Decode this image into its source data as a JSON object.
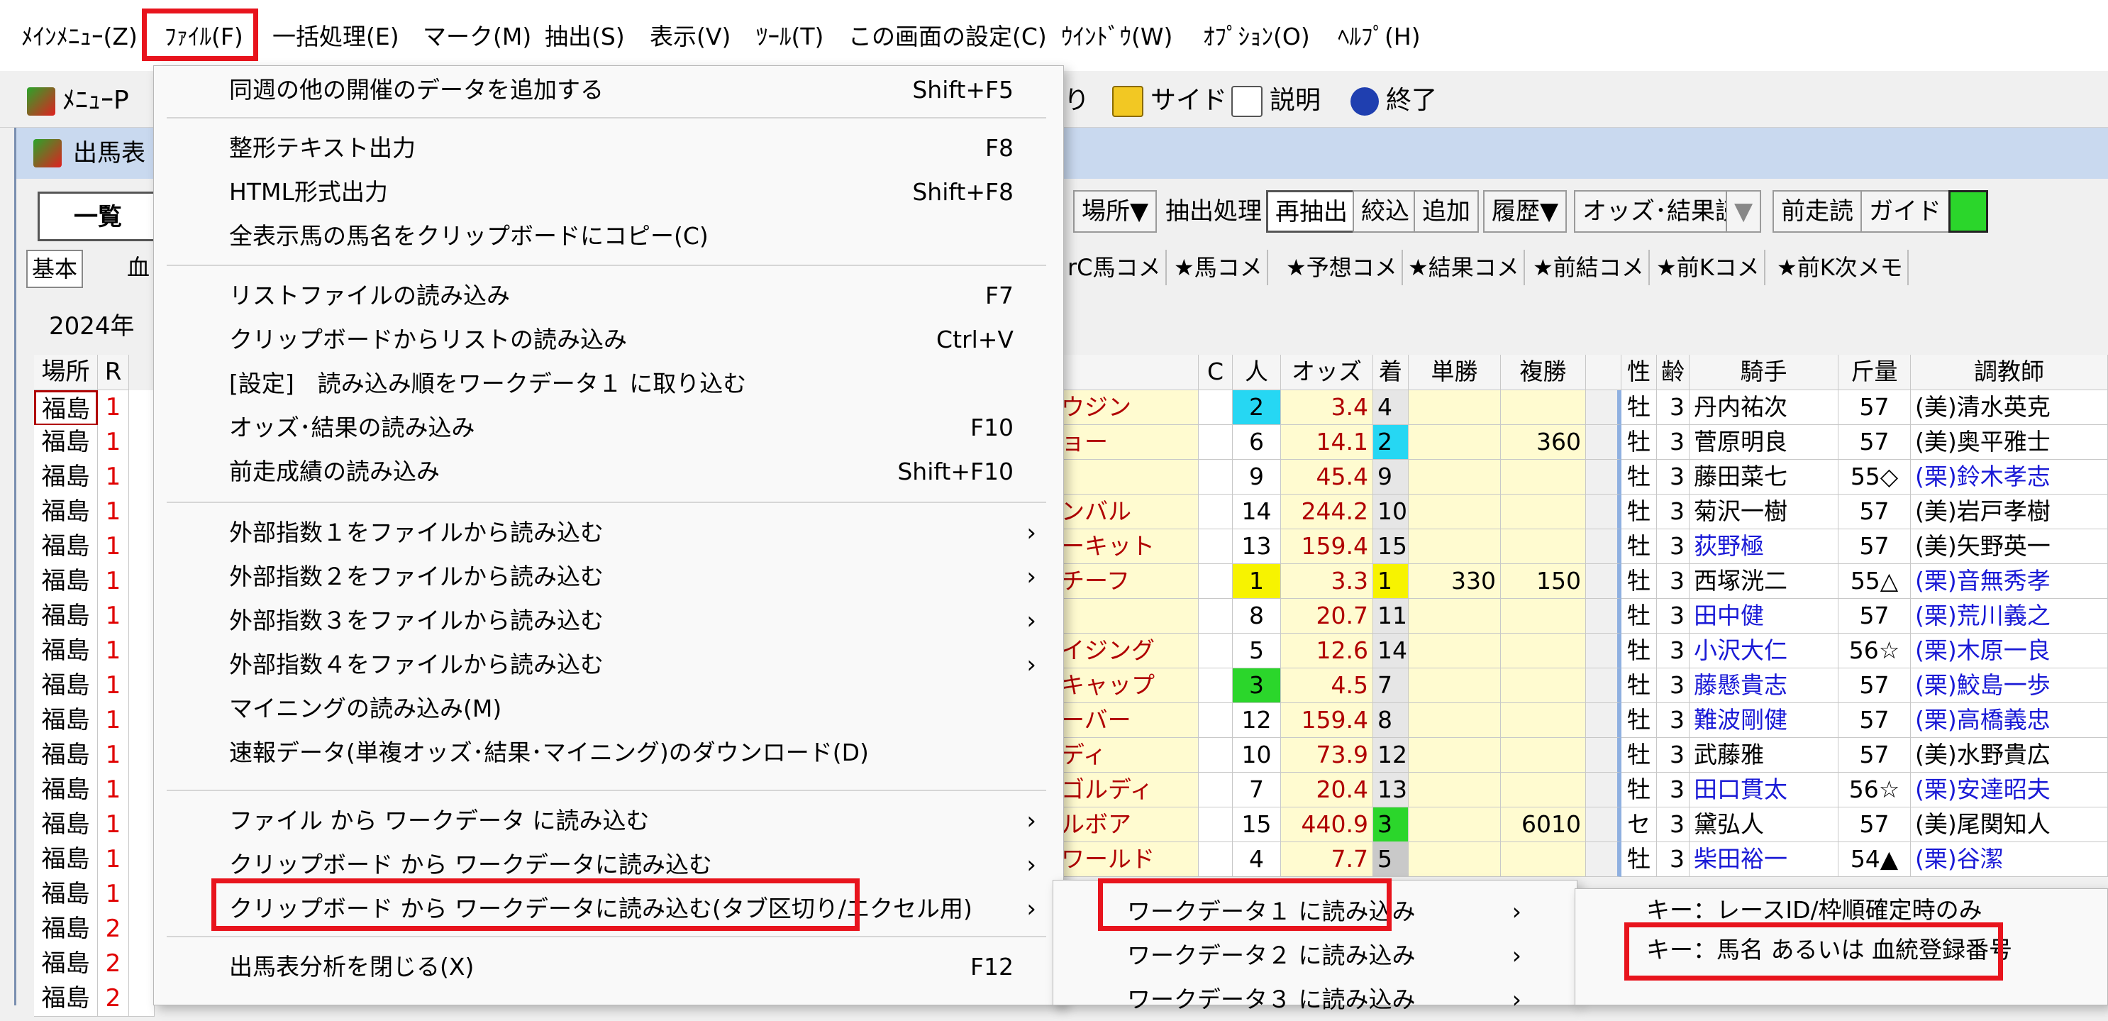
{
  "menubar": {
    "items": [
      "ﾒｲﾝﾒﾆｭｰ(Z)",
      "ﾌｧｲﾙ(F)",
      "一括処理(E)",
      "マーク(M)",
      "抽出(S)",
      "表示(V)",
      "ﾂｰﾙ(T)",
      "この画面の設定(C)",
      "ｳｲﾝﾄﾞｳ(W)",
      "ｵﾌﾟｼｮﾝ(O)",
      "ﾍﾙﾌﾟ(H)"
    ]
  },
  "toolbar": {
    "menu_label": "ﾒﾆｭｰP",
    "partial_label": "り",
    "side_label": "サイド",
    "explain_label": "説明",
    "exit_label": "終了"
  },
  "window": {
    "title_partial": "出馬表",
    "list_button": "一覧",
    "tab_basic": "基本",
    "tab_blood_partial": "血",
    "date_partial": "2024年",
    "buttons": [
      "場所▼",
      "抽出処理",
      "再抽出",
      "絞込",
      "追加",
      "履歴▼",
      "オッズ･結果読",
      "▼",
      "前走読",
      "ガイド"
    ],
    "comment_tabs": [
      "rC馬コメ",
      "★馬コメ",
      "★予想コメ",
      "★結果コメ",
      "★前結コメ",
      "★前Kコメ",
      "★前K次メモ"
    ]
  },
  "left_table": {
    "headers": [
      "場所",
      "R"
    ],
    "rows": [
      [
        "福島",
        "1"
      ],
      [
        "福島",
        "1"
      ],
      [
        "福島",
        "1"
      ],
      [
        "福島",
        "1"
      ],
      [
        "福島",
        "1"
      ],
      [
        "福島",
        "1"
      ],
      [
        "福島",
        "1"
      ],
      [
        "福島",
        "1"
      ],
      [
        "福島",
        "1"
      ],
      [
        "福島",
        "1"
      ],
      [
        "福島",
        "1"
      ],
      [
        "福島",
        "1"
      ],
      [
        "福島",
        "1"
      ],
      [
        "福島",
        "1"
      ],
      [
        "福島",
        "1"
      ],
      [
        "福島",
        "2"
      ],
      [
        "福島",
        "2"
      ],
      [
        "福島",
        "2"
      ]
    ]
  },
  "main_table": {
    "headers": [
      "C",
      "人",
      "オッズ",
      "着",
      "単勝",
      "複勝",
      "性",
      "齢",
      "騎手",
      "斤量",
      "調教師"
    ],
    "rows": [
      {
        "name": "ウジン",
        "pop": "2",
        "odds": "3.4",
        "fin": "4",
        "win": "",
        "place": "",
        "sex": "牡",
        "age": "3",
        "jockey": "丹内祐次",
        "weight": "57",
        "trainer": "(美)清水英克",
        "pop_hl": "#26d7f3",
        "fin_hl": "",
        "jblue": false,
        "tblue": false
      },
      {
        "name": "ョー",
        "pop": "6",
        "odds": "14.1",
        "fin": "2",
        "win": "",
        "place": "360",
        "sex": "牡",
        "age": "3",
        "jockey": "菅原明良",
        "weight": "57",
        "trainer": "(美)奥平雅士",
        "pop_hl": "",
        "fin_hl": "#26d7f3",
        "jblue": false,
        "tblue": false
      },
      {
        "name": "",
        "pop": "9",
        "odds": "45.4",
        "fin": "9",
        "win": "",
        "place": "",
        "sex": "牡",
        "age": "3",
        "jockey": "藤田菜七",
        "weight": "55◇",
        "trainer": "(栗)鈴木孝志",
        "pop_hl": "",
        "fin_hl": "",
        "jblue": false,
        "tblue": true
      },
      {
        "name": "ンバル",
        "pop": "14",
        "odds": "244.2",
        "fin": "10",
        "win": "",
        "place": "",
        "sex": "牡",
        "age": "3",
        "jockey": "菊沢一樹",
        "weight": "57",
        "trainer": "(美)岩戸孝樹",
        "pop_hl": "",
        "fin_hl": "",
        "jblue": false,
        "tblue": false
      },
      {
        "name": "ーキット",
        "pop": "13",
        "odds": "159.4",
        "fin": "15",
        "win": "",
        "place": "",
        "sex": "牡",
        "age": "3",
        "jockey": "荻野極",
        "weight": "57",
        "trainer": "(美)矢野英一",
        "pop_hl": "",
        "fin_hl": "",
        "jblue": true,
        "tblue": false
      },
      {
        "name": "チーフ",
        "pop": "1",
        "odds": "3.3",
        "fin": "1",
        "win": "330",
        "place": "150",
        "sex": "牡",
        "age": "3",
        "jockey": "西塚洸二",
        "weight": "55△",
        "trainer": "(栗)音無秀孝",
        "pop_hl": "#f7f300",
        "fin_hl": "#f7f300",
        "jblue": false,
        "tblue": true
      },
      {
        "name": "",
        "pop": "8",
        "odds": "20.7",
        "fin": "11",
        "win": "",
        "place": "",
        "sex": "牡",
        "age": "3",
        "jockey": "田中健",
        "weight": "57",
        "trainer": "(栗)荒川義之",
        "pop_hl": "",
        "fin_hl": "",
        "jblue": true,
        "tblue": true
      },
      {
        "name": "イジング",
        "pop": "5",
        "odds": "12.6",
        "fin": "14",
        "win": "",
        "place": "",
        "sex": "牡",
        "age": "3",
        "jockey": "小沢大仁",
        "weight": "56☆",
        "trainer": "(栗)木原一良",
        "pop_hl": "",
        "fin_hl": "",
        "jblue": true,
        "tblue": true
      },
      {
        "name": "キャップ",
        "pop": "3",
        "odds": "4.5",
        "fin": "7",
        "win": "",
        "place": "",
        "sex": "牡",
        "age": "3",
        "jockey": "藤懸貴志",
        "weight": "57",
        "trainer": "(栗)鮫島一歩",
        "pop_hl": "#2bd62b",
        "fin_hl": "",
        "jblue": true,
        "tblue": true
      },
      {
        "name": "ーバー",
        "pop": "12",
        "odds": "159.4",
        "fin": "8",
        "win": "",
        "place": "",
        "sex": "牡",
        "age": "3",
        "jockey": "難波剛健",
        "weight": "57",
        "trainer": "(栗)高橋義忠",
        "pop_hl": "",
        "fin_hl": "",
        "jblue": true,
        "tblue": true
      },
      {
        "name": "ディ",
        "pop": "10",
        "odds": "73.9",
        "fin": "12",
        "win": "",
        "place": "",
        "sex": "牡",
        "age": "3",
        "jockey": "武藤雅",
        "weight": "57",
        "trainer": "(美)水野貴広",
        "pop_hl": "",
        "fin_hl": "",
        "jblue": false,
        "tblue": false
      },
      {
        "name": "ゴルディ",
        "pop": "7",
        "odds": "20.4",
        "fin": "13",
        "win": "",
        "place": "",
        "sex": "牡",
        "age": "3",
        "jockey": "田口貫太",
        "weight": "56☆",
        "trainer": "(栗)安達昭夫",
        "pop_hl": "",
        "fin_hl": "",
        "jblue": true,
        "tblue": true
      },
      {
        "name": "ルボア",
        "pop": "15",
        "odds": "440.9",
        "fin": "3",
        "win": "",
        "place": "6010",
        "sex": "セ",
        "age": "3",
        "jockey": "黛弘人",
        "weight": "57",
        "trainer": "(美)尾関知人",
        "pop_hl": "",
        "fin_hl": "#2bd62b",
        "jblue": false,
        "tblue": false
      },
      {
        "name": "ワールド",
        "pop": "4",
        "odds": "7.7",
        "fin": "5",
        "win": "",
        "place": "",
        "sex": "牡",
        "age": "3",
        "jockey": "柴田裕一",
        "weight": "54▲",
        "trainer": "(栗)谷潔",
        "pop_hl": "",
        "fin_hl": "#c9c9c9",
        "jblue": true,
        "tblue": true
      }
    ]
  },
  "file_menu": {
    "items": [
      {
        "label": "同週の他の開催のデータを追加する",
        "shortcut": "Shift+F5"
      },
      {
        "label": "整形テキスト出力",
        "shortcut": "F8"
      },
      {
        "label": "HTML形式出力",
        "shortcut": "Shift+F8"
      },
      {
        "label": "全表示馬の馬名をクリップボードにコピー(C)",
        "shortcut": ""
      },
      {
        "label": "リストファイルの読み込み",
        "shortcut": "F7"
      },
      {
        "label": "クリップボードからリストの読み込み",
        "shortcut": "Ctrl+V"
      },
      {
        "label": "[設定]　読み込み順をワークデータ１ に取り込む",
        "shortcut": ""
      },
      {
        "label": "オッズ･結果の読み込み",
        "shortcut": "F10"
      },
      {
        "label": "前走成績の読み込み",
        "shortcut": "Shift+F10"
      },
      {
        "label": "外部指数１をファイルから読み込む",
        "shortcut": ""
      },
      {
        "label": "外部指数２をファイルから読み込む",
        "shortcut": ""
      },
      {
        "label": "外部指数３をファイルから読み込む",
        "shortcut": ""
      },
      {
        "label": "外部指数４をファイルから読み込む",
        "shortcut": ""
      },
      {
        "label": "マイニングの読み込み(M)",
        "shortcut": ""
      },
      {
        "label": "速報データ(単複オッズ･結果･マイニング)のダウンロード(D)",
        "shortcut": ""
      },
      {
        "label": "ファイル から ワークデータ に読み込む",
        "shortcut": ""
      },
      {
        "label": "クリップボード から ワークデータに読み込む",
        "shortcut": ""
      },
      {
        "label": "クリップボード から ワークデータに読み込む(タブ区切り/エクセル用)",
        "shortcut": ""
      },
      {
        "label": "出馬表分析を閉じる(X)",
        "shortcut": "F12"
      }
    ],
    "arrow": "›"
  },
  "submenu_workdata": {
    "items": [
      "ワークデータ１ に読み込み",
      "ワークデータ２ に読み込み",
      "ワークデータ３ に読み込み"
    ]
  },
  "submenu_key": {
    "items": [
      "キー：レースID/枠順確定時のみ",
      "キー：馬名 あるいは 血統登録番号"
    ]
  },
  "colors": {
    "highlight_red": "#e8141d",
    "name_yellow": "#fffbd0",
    "odds_red": "#b00000",
    "blue_text": "#1a1ad6"
  }
}
